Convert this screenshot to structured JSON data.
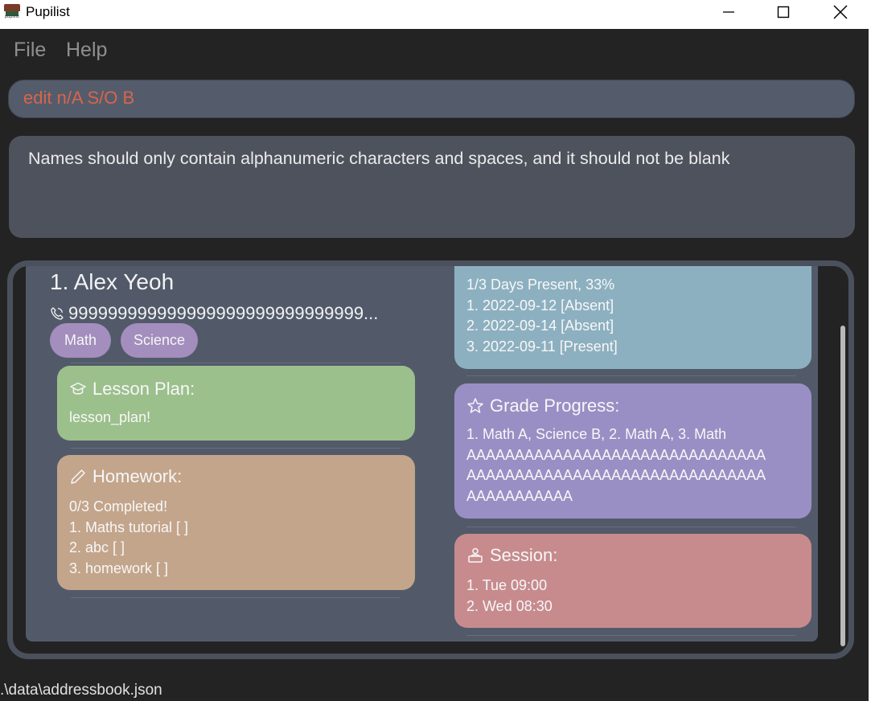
{
  "window": {
    "title": "Pupilist",
    "icon_label": "pupilist"
  },
  "menu": {
    "items": [
      {
        "label": "File"
      },
      {
        "label": "Help"
      }
    ]
  },
  "command": {
    "value": "edit n/A S/O B",
    "text_color": "#d8654a"
  },
  "result": {
    "message": "Names should only contain alphanumeric characters and spaces, and it should not be blank"
  },
  "person": {
    "index_name": "1.  Alex Yeoh",
    "phone": "999999999999999999999999999999...",
    "tags": [
      "Math",
      "Science"
    ],
    "lesson_plan": {
      "title": "Lesson Plan:",
      "icon": "graduation-cap-icon",
      "value": "lesson_plan!"
    },
    "homework": {
      "title": "Homework:",
      "icon": "pencil-icon",
      "lines": [
        "0/3 Completed!",
        "1. Maths tutorial [ ]",
        "2. abc [ ]",
        "3. homework [ ]"
      ]
    },
    "attendance": {
      "lines": [
        "1/3 Days Present, 33%",
        "1. 2022-09-12 [Absent]",
        "2. 2022-09-14 [Absent]",
        "3. 2022-09-11 [Present]"
      ]
    },
    "grade_progress": {
      "title": "Grade Progress:",
      "icon": "star-icon",
      "lines": [
        "1. Math A, Science B, 2. Math A, 3. Math",
        "AAAAAAAAAAAAAAAAAAAAAAAAAAAAAAA",
        "AAAAAAAAAAAAAAAAAAAAAAAAAAAAAAA",
        "AAAAAAAAAAA"
      ]
    },
    "session": {
      "title": "Session:",
      "icon": "person-desk-icon",
      "lines": [
        "1. Tue 09:00",
        "2. Wed 08:30"
      ]
    }
  },
  "status": {
    "path": ".\\data\\addressbook.json"
  },
  "colors": {
    "lesson": "#9cc08c",
    "homework": "#c3a58b",
    "attendance": "#8db0c0",
    "grade": "#9a8fc4",
    "session": "#c78b8e",
    "tag": "#a48ebe"
  }
}
